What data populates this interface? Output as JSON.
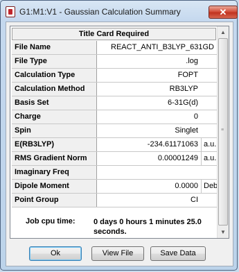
{
  "window": {
    "title": "G1:M1:V1 - Gaussian Calculation Summary",
    "close_label": "✕"
  },
  "table": {
    "header": "Title Card Required",
    "rows": [
      {
        "label": "File Name",
        "value": "REACT_ANTI_B3LYP_631GD",
        "unit": ""
      },
      {
        "label": "File Type",
        "value": ".log",
        "unit": ""
      },
      {
        "label": "Calculation Type",
        "value": "FOPT",
        "unit": ""
      },
      {
        "label": "Calculation Method",
        "value": "RB3LYP",
        "unit": ""
      },
      {
        "label": "Basis Set",
        "value": "6-31G(d)",
        "unit": ""
      },
      {
        "label": "Charge",
        "value": "0",
        "unit": ""
      },
      {
        "label": "Spin",
        "value": "Singlet",
        "unit": ""
      },
      {
        "label": "E(RB3LYP)",
        "value": "-234.61171063",
        "unit": "a.u."
      },
      {
        "label": "RMS Gradient Norm",
        "value": "0.00001249",
        "unit": "a.u."
      },
      {
        "label": "Imaginary Freq",
        "value": "",
        "unit": ""
      },
      {
        "label": "Dipole Moment",
        "value": "0.0000",
        "unit": "Deb"
      },
      {
        "label": "Point Group",
        "value": "CI",
        "unit": ""
      }
    ],
    "cpu_label": "Job cpu time:",
    "cpu_value": "0 days  0 hours  1 minutes 25.0 seconds."
  },
  "buttons": {
    "ok": "Ok",
    "view_file": "View File",
    "save_data": "Save Data"
  },
  "icons": {
    "app": "gaussview-app-icon",
    "close": "close-icon",
    "scroll_up": "scroll-up-arrow-icon",
    "scroll_down": "scroll-down-arrow-icon"
  }
}
